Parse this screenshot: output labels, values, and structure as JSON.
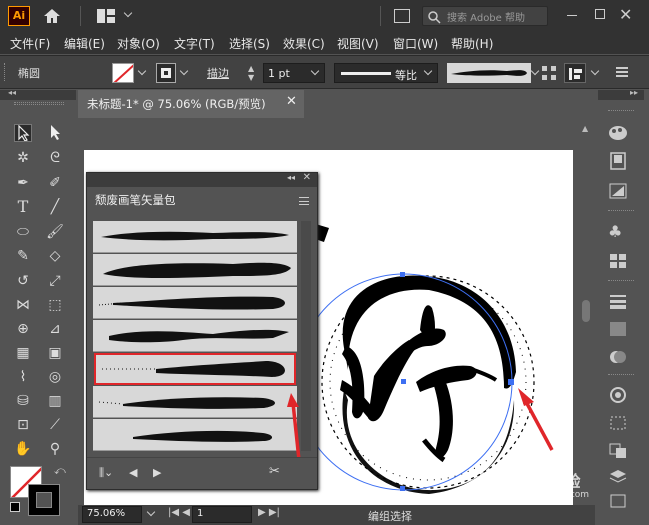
{
  "app": {
    "logo": "Ai",
    "search_placeholder": "搜索 Adobe 帮助"
  },
  "menu": [
    "文件(F)",
    "编辑(E)",
    "对象(O)",
    "文字(T)",
    "选择(S)",
    "效果(C)",
    "视图(V)",
    "窗口(W)",
    "帮助(H)"
  ],
  "control": {
    "selection_label": "椭圆",
    "stroke_label": "描边",
    "stroke_value": "1 pt",
    "profile_label": "等比"
  },
  "document": {
    "tab_title": "未标题-1* @ 75.06% (RGB/预览)"
  },
  "brush_panel": {
    "title": "颓废画笔矢量包",
    "selected_index": 4
  },
  "status": {
    "zoom": "75.06%",
    "page": "1",
    "mode": "编组选择"
  },
  "watermark": {
    "line1": "Bai经验",
    "line2": "jingyan.baidu.com"
  },
  "artwork": {
    "character": "好"
  },
  "colors": {
    "accent_red": "#e0262a",
    "selection_blue": "#3d6ff2"
  }
}
